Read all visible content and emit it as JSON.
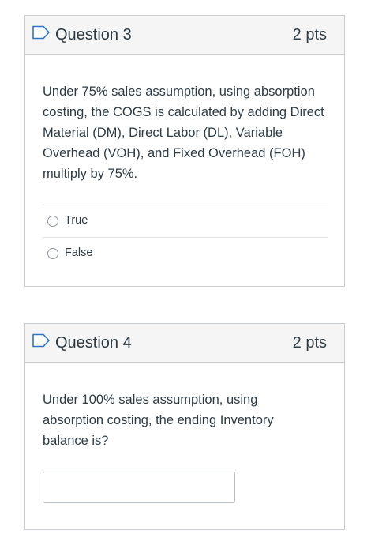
{
  "questions": [
    {
      "title": "Question 3",
      "points": "2 pts",
      "text": "Under 75% sales assumption,  using absorption costing, the COGS is calculated by adding Direct Material (DM), Direct Labor (DL), Variable Overhead (VOH), and Fixed Overhead (FOH) multiply by 75%.",
      "answers": [
        {
          "label": "True"
        },
        {
          "label": "False"
        }
      ],
      "flag_icon": "flag-outline-icon"
    },
    {
      "title": "Question 4",
      "points": "2 pts",
      "text": "Under 100% sales assumption,  using absorption costing, the ending Inventory balance is?",
      "input": {
        "value": "",
        "placeholder": ""
      },
      "flag_icon": "flag-outline-icon"
    }
  ],
  "colors": {
    "text": "#2d3b45",
    "header_bg": "#f5f5f5",
    "border": "#c7cdd1",
    "flag_stroke": "#2d74c4"
  }
}
